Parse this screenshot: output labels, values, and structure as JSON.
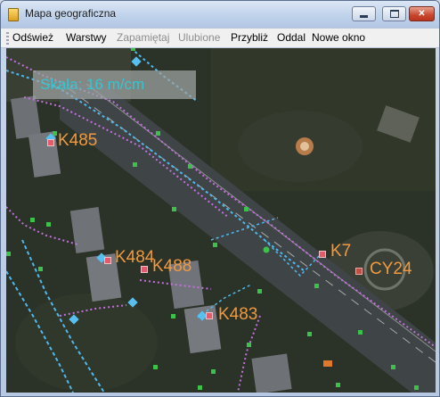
{
  "window": {
    "title": "Mapa geograficzna",
    "controls": {
      "minimize": "",
      "maximize": "",
      "close": "✕"
    }
  },
  "menu": {
    "items": [
      {
        "label": "Odśwież",
        "enabled": true
      },
      {
        "label": "Warstwy",
        "enabled": true
      },
      {
        "label": "Zapamiętaj",
        "enabled": false
      },
      {
        "label": "Ulubione",
        "enabled": false
      },
      {
        "label": "Przybliż",
        "enabled": true
      },
      {
        "label": "Oddal",
        "enabled": true
      },
      {
        "label": "Nowe okno",
        "enabled": true
      }
    ]
  },
  "map": {
    "scale_label": "Skala: 16 m/cm",
    "markers": [
      {
        "label": "K485"
      },
      {
        "label": "K484"
      },
      {
        "label": "K488"
      },
      {
        "label": "K483"
      },
      {
        "label": "K7"
      },
      {
        "label": "CY24"
      }
    ],
    "colors": {
      "label": "#f09a40",
      "scale_text": "#33c6d2",
      "node": "#3cc24b",
      "cable_blue": "#4fb9ee",
      "cable_magenta": "#c56fe0"
    }
  }
}
